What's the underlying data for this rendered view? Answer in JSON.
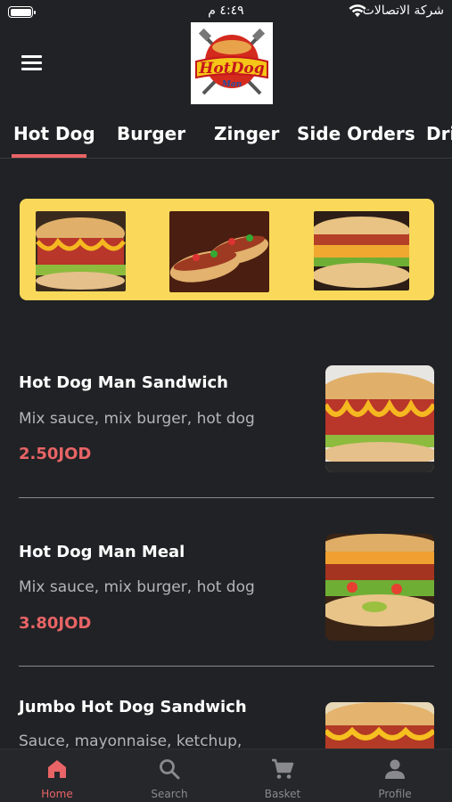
{
  "status_bar": {
    "time": "٤:٤٩ م",
    "carrier": "شركة الاتصالات"
  },
  "header": {
    "logo_text_line1": "HotDog",
    "logo_text_line2": "Man"
  },
  "tabs": [
    {
      "label": "Hot Dog",
      "active": true
    },
    {
      "label": "Burger",
      "active": false
    },
    {
      "label": "Zinger",
      "active": false
    },
    {
      "label": "Side Orders",
      "active": false
    },
    {
      "label": "Drinks",
      "active": false
    }
  ],
  "items": [
    {
      "title": "Hot Dog Man Sandwich",
      "description": "Mix sauce, mix burger, hot dog",
      "price": "2.50JOD"
    },
    {
      "title": "Hot Dog Man Meal",
      "description": "Mix sauce, mix burger, hot dog",
      "price": "3.80JOD"
    },
    {
      "title": "Jumbo Hot Dog Sandwich",
      "description": "Sauce, mayonnaise, ketchup,",
      "price": ""
    }
  ],
  "bottom_nav": [
    {
      "label": "Home",
      "icon": "home-icon",
      "active": true
    },
    {
      "label": "Search",
      "icon": "search-icon",
      "active": false
    },
    {
      "label": "Basket",
      "icon": "cart-icon",
      "active": false
    },
    {
      "label": "Profile",
      "icon": "profile-icon",
      "active": false
    }
  ],
  "colors": {
    "background": "#212225",
    "accent": "#e86466",
    "banner": "#fad95a"
  }
}
